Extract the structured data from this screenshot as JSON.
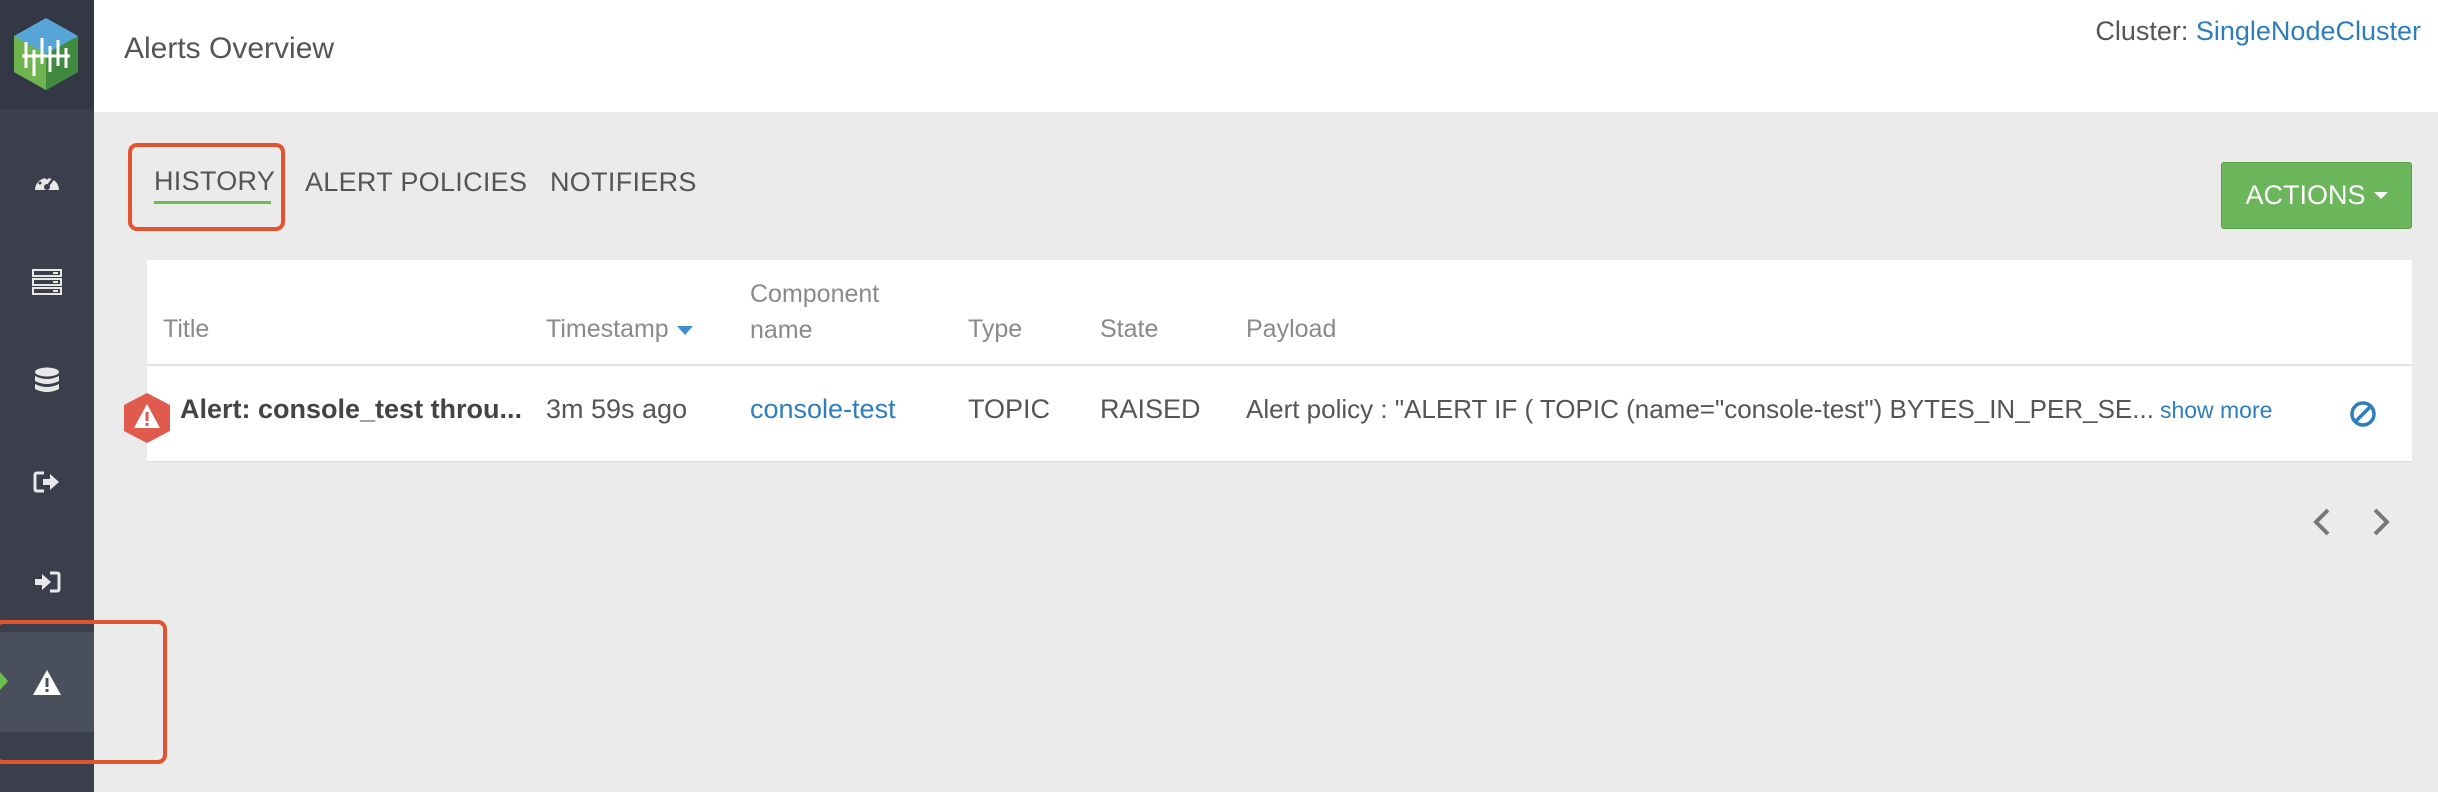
{
  "header": {
    "title": "Alerts Overview",
    "cluster_label": "Cluster:",
    "cluster_name": "SingleNodeCluster"
  },
  "sidebar": {
    "items": [
      {
        "icon": "dashboard-gauge-icon"
      },
      {
        "icon": "servers-icon"
      },
      {
        "icon": "database-icon"
      },
      {
        "icon": "sign-out-icon"
      },
      {
        "icon": "sign-in-icon"
      },
      {
        "icon": "warning-icon",
        "active": true
      }
    ]
  },
  "tabs": [
    {
      "label": "HISTORY",
      "active": true
    },
    {
      "label": "ALERT POLICIES"
    },
    {
      "label": "NOTIFIERS"
    }
  ],
  "actions": {
    "label": "ACTIONS"
  },
  "table": {
    "columns": [
      "Title",
      "Timestamp",
      "Component",
      "name",
      "Type",
      "State",
      "Payload"
    ],
    "rows": [
      {
        "title": "Alert: console_test throu...",
        "timestamp": "3m 59s ago",
        "component": "console-test",
        "type": "TOPIC",
        "state": "RAISED",
        "payload": "Alert policy : \"ALERT IF ( TOPIC (name=\"console-test\") BYTES_IN_PER_SE...",
        "show_more": "show more"
      }
    ]
  },
  "colors": {
    "accent_green": "#6bb55a",
    "link_blue": "#2e7dbd",
    "alert_red": "#e05a4e",
    "highlight": "#e4532f"
  }
}
